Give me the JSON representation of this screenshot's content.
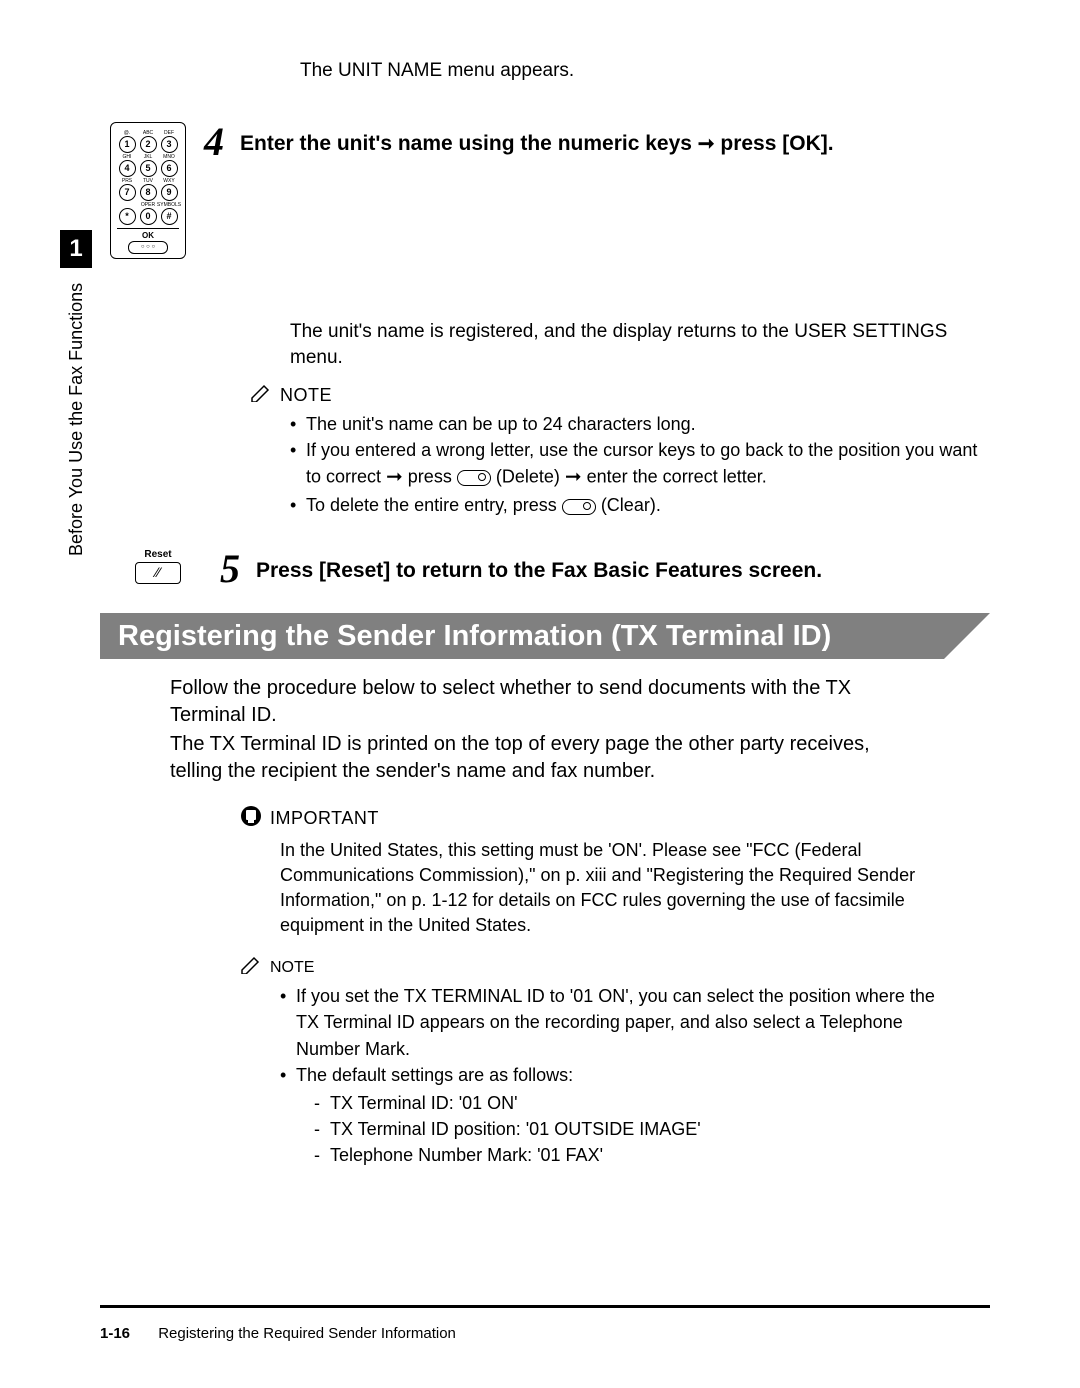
{
  "intro": "The UNIT NAME menu appears.",
  "sideTab": {
    "chapter": "1",
    "label": "Before You Use the Fax Functions"
  },
  "keypad": {
    "rows": [
      [
        {
          "sub": "@.",
          "n": "1"
        },
        {
          "sub": "ABC",
          "n": "2"
        },
        {
          "sub": "DEF",
          "n": "3"
        }
      ],
      [
        {
          "sub": "GHI",
          "n": "4"
        },
        {
          "sub": "JKL",
          "n": "5"
        },
        {
          "sub": "MNO",
          "n": "6"
        }
      ],
      [
        {
          "sub": "PRS",
          "n": "7"
        },
        {
          "sub": "TUV",
          "n": "8"
        },
        {
          "sub": "WXY",
          "n": "9"
        }
      ],
      [
        {
          "sub": "",
          "n": "*"
        },
        {
          "sub": "OPER",
          "n": "0"
        },
        {
          "sub": "SYMBOLS",
          "n": "#"
        }
      ]
    ],
    "okLabel": "OK",
    "okDots": "○ ○ ○"
  },
  "step4": {
    "num": "4",
    "heading_a": "Enter the unit's name using the numeric keys ",
    "heading_b": " press [OK].",
    "arrow": "➞",
    "result": "The unit's name is registered, and the display returns to the USER SETTINGS menu."
  },
  "note1": {
    "label": "NOTE",
    "items": {
      "a": "The unit's name can be up to 24 characters long.",
      "b1": "If you entered a wrong letter, use the cursor keys to go back to the position you want to correct ",
      "b2": " press ",
      "b3": " (Delete) ",
      "b4": " enter the correct letter.",
      "c1": "To delete the entire entry, press ",
      "c2": " (Clear)."
    },
    "arrow": "➞"
  },
  "step5": {
    "num": "5",
    "resetLabel": "Reset",
    "resetGlyph": "⁄⁄",
    "heading": "Press [Reset] to return to the Fax Basic Features screen."
  },
  "section": {
    "title": "Registering the Sender Information (TX Terminal ID)"
  },
  "desc": {
    "p1": "Follow the procedure below to select whether to send documents with the TX Terminal ID.",
    "p2": "The TX Terminal ID is printed on the top of every page the other party receives, telling the recipient the sender's name and fax number."
  },
  "important": {
    "label": "IMPORTANT",
    "body": "In the United States, this setting must be 'ON'. Please see \"FCC (Federal Communications Commission),\" on p. xiii and \"Registering the Required Sender Information,\" on p. 1-12 for details on FCC rules governing the use of facsimile equipment in the United States."
  },
  "note2": {
    "label": "NOTE",
    "items": {
      "a": "If you set the TX TERMINAL ID to '01 ON', you can select the position where the TX Terminal ID appears on the recording paper, and also select a Telephone Number Mark.",
      "b": "The default settings are as follows:",
      "s1": "TX Terminal ID: '01 ON'",
      "s2": "TX Terminal ID position: '01 OUTSIDE IMAGE'",
      "s3": "Telephone Number Mark: '01 FAX'"
    }
  },
  "footer": {
    "page": "1-16",
    "title": "Registering the Required Sender Information"
  }
}
